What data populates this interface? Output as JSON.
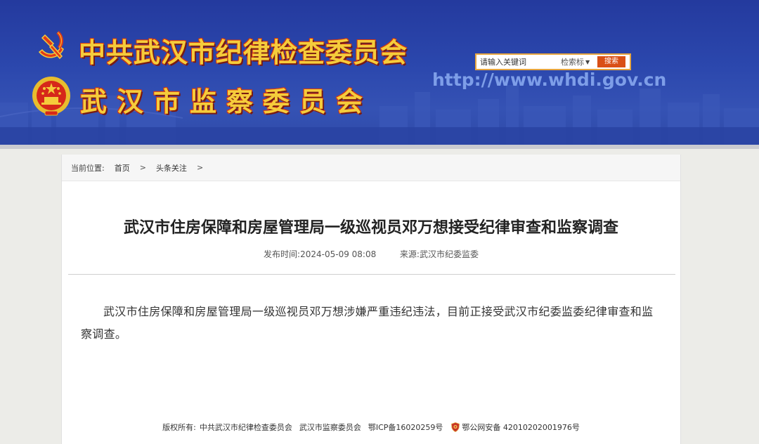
{
  "header": {
    "title_party": "中共武汉市纪律检查委员会",
    "title_gov": "武汉市监察委员会",
    "site_url": "http://www.whdi.gov.cn",
    "search": {
      "placeholder": "请输入关键词",
      "select_value": "检索标",
      "button_label": "搜索"
    }
  },
  "breadcrumb": {
    "label": "当前位置:",
    "items": [
      "首页",
      "头条关注"
    ],
    "separator": ">"
  },
  "article": {
    "title": "武汉市住房保障和房屋管理局一级巡视员邓万想接受纪律审查和监察调查",
    "publish_label": "发布时间:",
    "publish_time": "2024-05-09 08:08",
    "source_label": "来源:",
    "source": "武汉市纪委监委",
    "body": "武汉市住房保障和房屋管理局一级巡视员邓万想涉嫌严重违纪违法，目前正接受武汉市纪委监委纪律审查和监察调查。"
  },
  "footer": {
    "copyright_label": "版权所有:",
    "org1": "中共武汉市纪律检查委员会",
    "org2": "武汉市监察委员会",
    "icp": "鄂ICP备16020259号",
    "police_record": "鄂公网安备 42010202001976号"
  },
  "colors": {
    "banner_blue": "#2b47ad",
    "title_gold": "#f5cc3b",
    "title_red": "#d8360f",
    "search_button": "#d94f16"
  },
  "icons": {
    "party_emblem": "hammer-sickle-emblem-icon",
    "state_emblem": "national-emblem-icon",
    "police_badge": "police-badge-icon",
    "select_arrow": "chevron-down-icon"
  }
}
